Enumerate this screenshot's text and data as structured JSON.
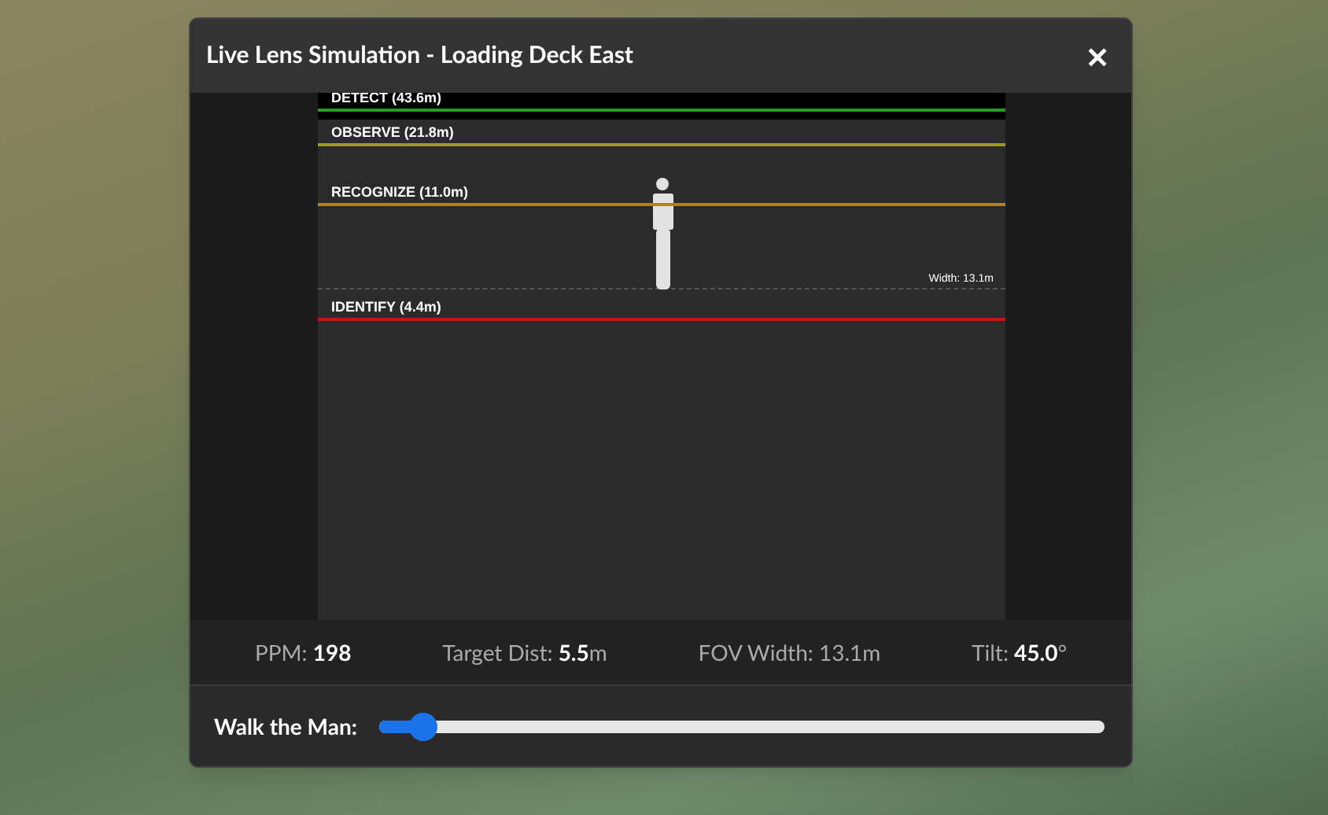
{
  "dialog": {
    "title": "Live Lens Simulation - Loading Deck East",
    "close_label": "✕"
  },
  "zones": [
    {
      "label": "DETECT (43.6m)",
      "color": "#22a022"
    },
    {
      "label": "OBSERVE (21.8m)",
      "color": "#9c9a24"
    },
    {
      "label": "RECOGNIZE (11.0m)",
      "color": "#c27c12"
    },
    {
      "label": "IDENTIFY (4.4m)",
      "color": "#b81a1a"
    }
  ],
  "fov_width_label": "Width: 13.1m",
  "stats": [
    "PPM: **198**",
    "Target Dist: **5.5**m",
    "FOV Width: 13.1m",
    "Tilt: **45.0**°"
  ],
  "slider": {
    "label": "Walk the Man:",
    "level": 0.05
  }
}
